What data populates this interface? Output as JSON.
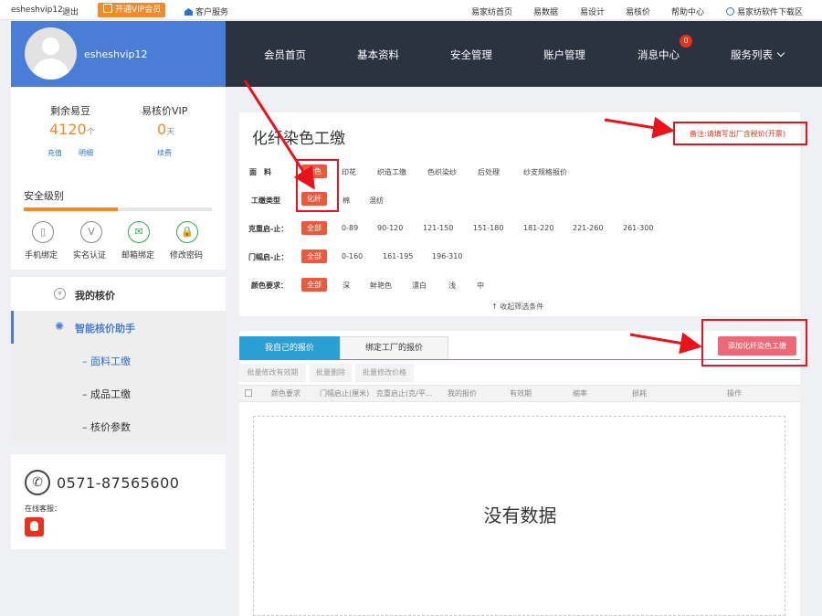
{
  "topbar": {
    "username": "esheshvip12",
    "logout": "退出",
    "vip_button": "开通VIP会员",
    "customer_service": "客户服务",
    "links": [
      "易家纺首页",
      "易数据",
      "易设计",
      "易核价",
      "帮助中心"
    ],
    "download": "易家纺软件下载区"
  },
  "header": {
    "username": "esheshvip12",
    "nav": [
      "会员首页",
      "基本资料",
      "安全管理",
      "账户管理",
      "消息中心",
      "服务列表"
    ],
    "message_count": "0"
  },
  "sidebar": {
    "beans_label": "剩余易豆",
    "beans_value": "4120",
    "beans_unit": "个",
    "recharge": "充值",
    "detail": "明细",
    "vip_label": "易核价VIP",
    "vip_value": "0",
    "vip_unit": "天",
    "renew": "续费",
    "security_title": "安全级别",
    "security_progress": 0.5,
    "security_items": [
      "手机绑定",
      "实名认证",
      "邮箱绑定",
      "修改密码"
    ],
    "menu": {
      "my_pricing": "我的核价",
      "assistant": "智能核价助手",
      "sub_items": [
        "面料工缴",
        "成品工缴",
        "核价参数"
      ]
    },
    "contact": {
      "phone": "0571-87565600",
      "online_label": "在线客服："
    }
  },
  "filter": {
    "title": "化纤染色工缴",
    "note": "备注:请填写出厂含税价(开票)",
    "fabric_label": "面　料",
    "fabric_options": [
      "染色",
      "印花",
      "织造工缴",
      "色织染纱",
      "后处理",
      "纱支规格报价"
    ],
    "process_label": "工缴类型",
    "process_options": [
      "化纤",
      "棉",
      "混纺"
    ],
    "weight_label": "克重启-止：",
    "weight_options": [
      "全部",
      "0-89",
      "90-120",
      "121-150",
      "151-180",
      "181-220",
      "221-260",
      "261-300"
    ],
    "width_label": "门幅启-止：",
    "width_options": [
      "全部",
      "0-160",
      "161-195",
      "196-310"
    ],
    "color_label": "颜色要求：",
    "color_options": [
      "全部",
      "深",
      "鲜艳色",
      "漂白",
      "浅",
      "中"
    ],
    "collapse": "↑ 收起筛选条件"
  },
  "list": {
    "tab_active": "我自己的报价",
    "tab_other": "绑定工厂的报价",
    "add_button": "添加化纤染色工缴",
    "bulk_actions": [
      "批量修改有效期",
      "批量删除",
      "批量修改价格"
    ],
    "columns": [
      "颜色要求",
      "门幅启止(厘米)",
      "克重启止(克/平...",
      "我的报价",
      "有效期",
      "缩率",
      "损耗",
      "操作"
    ],
    "empty_text": "没有数据"
  },
  "colors": {
    "accent_blue": "#4a7ed6",
    "header_dark": "#2b3240",
    "orange": "#f08a2a",
    "tag_red": "#e85a3e",
    "annotation_red": "#e8131b"
  }
}
